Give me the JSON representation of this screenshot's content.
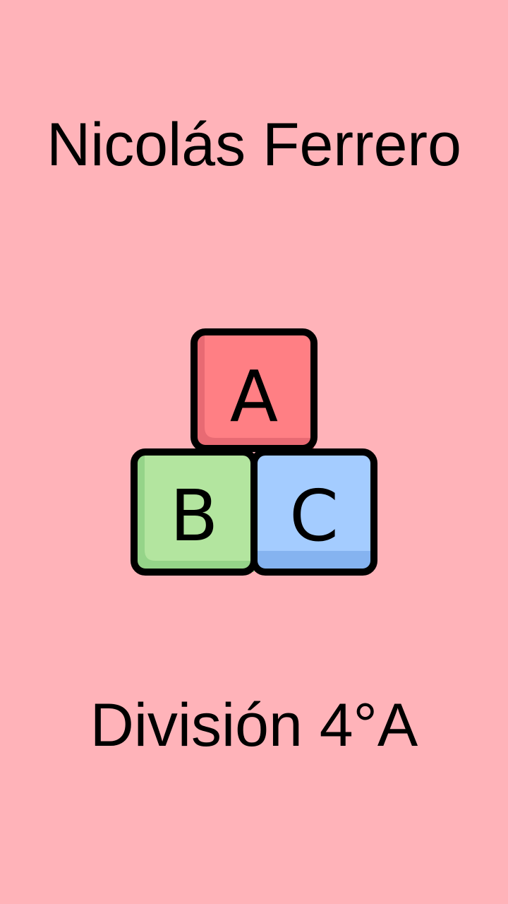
{
  "name": "Nicolás Ferrero",
  "division": "División 4°A",
  "blocks": [
    {
      "letter": "A",
      "color": "#ff7f84",
      "shade": "#e86a73"
    },
    {
      "letter": "B",
      "color": "#b3e59f",
      "shade": "#95d489"
    },
    {
      "letter": "C",
      "color": "#a4ccff",
      "shade": "#85b3f0"
    }
  ],
  "background": "#ffb3b9"
}
